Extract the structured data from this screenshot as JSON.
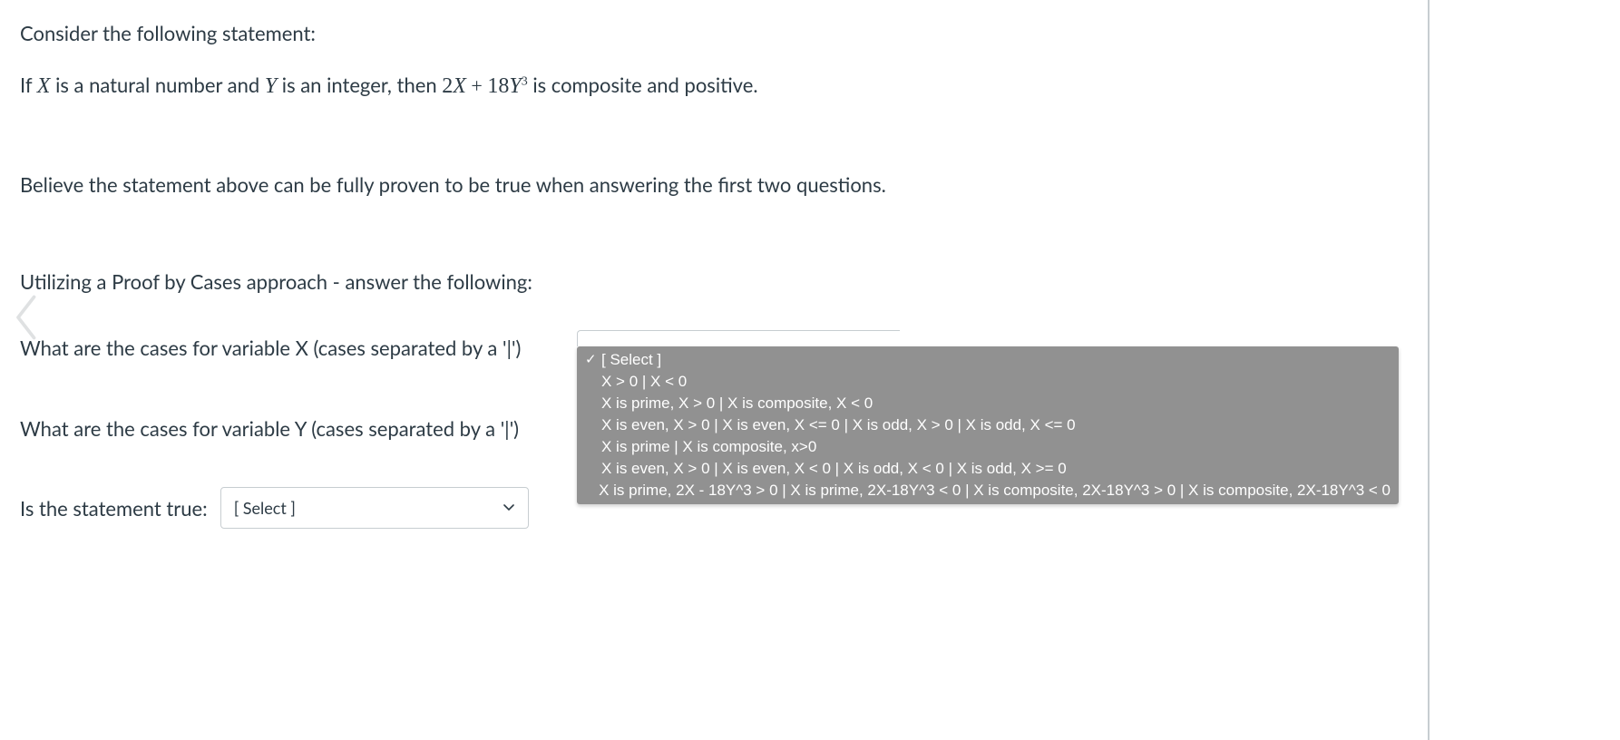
{
  "heading": "Consider the following statement:",
  "statement": {
    "prefix": "If ",
    "var1": "X",
    "mid1": " is a natural number and ",
    "var2": "Y",
    "mid2": "  is an integer, then ",
    "expr_2": "2",
    "expr_X": "X",
    "expr_plus": " + ",
    "expr_18": "18",
    "expr_Y": "Y",
    "expr_exp": "3",
    "suffix": "  is composite and positive."
  },
  "believe": "Believe the statement above can be fully proven to be true when answering the first two questions.",
  "utilizing": "Utilizing a Proof by Cases approach - answer the following:",
  "q1_label": "What are the cases for variable X (cases separated by a '|')",
  "q2_label": "What are the cases for variable Y (cases separated by a '|')",
  "q3_label": "Is the statement true:",
  "select_placeholder": "[ Select ]",
  "dropdown": {
    "selected": "[ Select ]",
    "options": [
      "X > 0 | X < 0",
      "X is prime, X > 0 | X is composite, X < 0",
      "X is even, X > 0 | X is even, X <= 0 | X is odd, X > 0 | X is odd, X <= 0",
      "X is prime | X is composite, x>0",
      "X is even, X > 0 | X is even, X < 0 | X is odd, X < 0 | X is odd, X >= 0",
      "X is prime, 2X - 18Y^3 > 0 | X is prime, 2X-18Y^3 < 0 | X is composite, 2X-18Y^3 > 0 | X is composite, 2X-18Y^3 < 0"
    ]
  }
}
